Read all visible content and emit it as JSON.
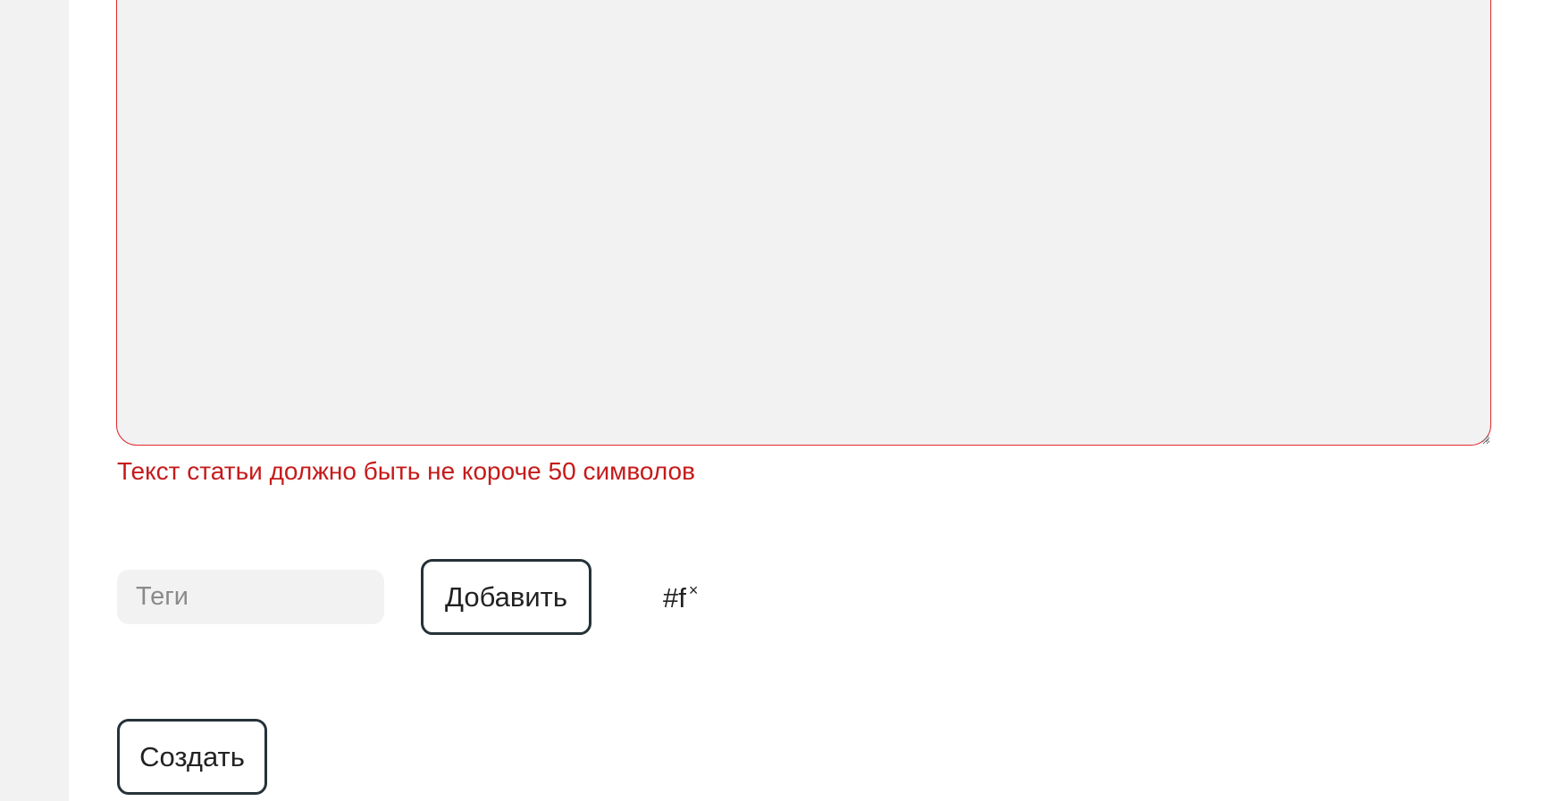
{
  "article_form": {
    "body_field": {
      "value": "",
      "error": "Текст статьи должно быть не короче 50 символов"
    },
    "tags_field": {
      "placeholder": "Теги",
      "value": ""
    },
    "add_tag_button_label": "Добавить",
    "tags": [
      {
        "label": "#f",
        "remove_glyph": "×"
      }
    ],
    "create_button_label": "Создать"
  },
  "colors": {
    "page_background": "#f2f2f2",
    "panel_background": "#ffffff",
    "error": "#c61a1a",
    "invalid_border": "#e0282e",
    "button_border": "#253238"
  }
}
